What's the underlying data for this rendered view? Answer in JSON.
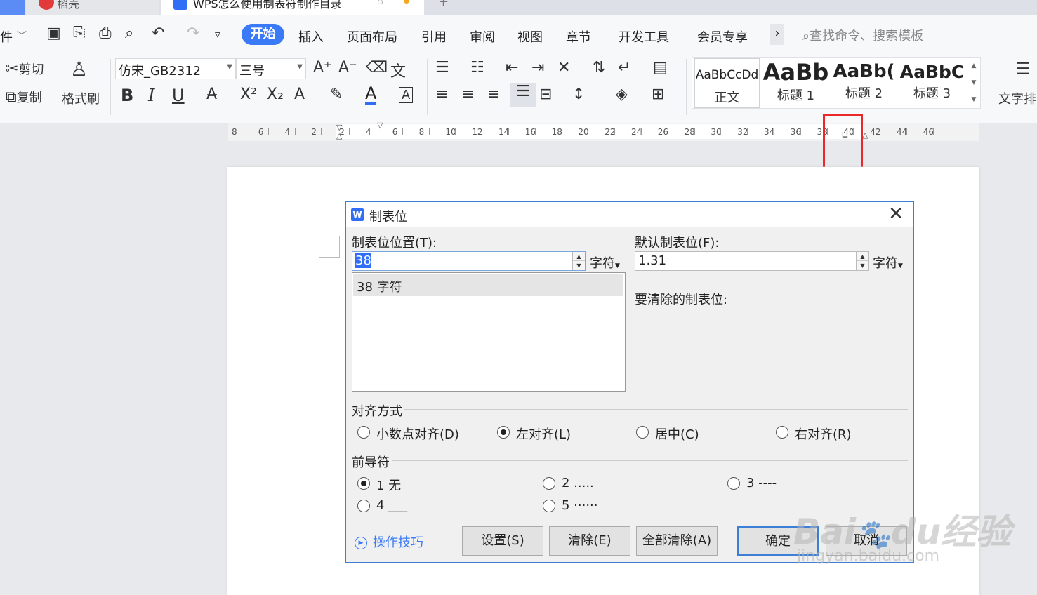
{
  "tabs": {
    "tab1_title": "稻壳",
    "tab2_title": "WPS怎么使用制表符制作目录",
    "new_tab": "+"
  },
  "menu": {
    "file": "件",
    "items": [
      "开始",
      "插入",
      "页面布局",
      "引用",
      "审阅",
      "视图",
      "章节",
      "开发工具",
      "会员专享"
    ],
    "more": "›",
    "search_placeholder": "查找命令、搜索模板"
  },
  "toolbar": {
    "cut": "剪切",
    "copy": "复制",
    "format_painter": "格式刷",
    "font_name": "仿宋_GB2312",
    "font_size": "三号",
    "bold": "B",
    "italic": "I",
    "underline": "U",
    "text_layout": "文字排"
  },
  "styles": [
    {
      "preview": "AaBbCcDd",
      "name": "正文"
    },
    {
      "preview": "AaBb",
      "name": "标题 1"
    },
    {
      "preview": "AaBb(",
      "name": "标题 2"
    },
    {
      "preview": "AaBbC",
      "name": "标题 3"
    }
  ],
  "ruler": {
    "labels": [
      "8",
      "6",
      "4",
      "2",
      "2",
      "4",
      "6",
      "8",
      "10",
      "12",
      "14",
      "16",
      "18",
      "20",
      "22",
      "24",
      "26",
      "28",
      "30",
      "32",
      "34",
      "36",
      "38",
      "40",
      "42",
      "44",
      "46"
    ]
  },
  "dialog": {
    "title": "制表位",
    "tab_position_label": "制表位位置(T):",
    "tab_position_value": "38",
    "unit": "字符",
    "default_tab_label": "默认制表位(F):",
    "default_tab_value": "1.31",
    "tab_list": [
      "38 字符"
    ],
    "to_clear_label": "要清除的制表位:",
    "alignment_label": "对齐方式",
    "alignment_options": [
      "小数点对齐(D)",
      "左对齐(L)",
      "居中(C)",
      "右对齐(R)"
    ],
    "alignment_selected": "左对齐(L)",
    "leader_label": "前导符",
    "leader_options": [
      "1 无",
      "2 .....",
      "3 ----",
      "4 ___",
      "5 ······"
    ],
    "leader_selected": "1 无",
    "tips": "操作技巧",
    "buttons": {
      "set": "设置(S)",
      "clear": "清除(E)",
      "clear_all": "全部清除(A)",
      "ok": "确定",
      "cancel": "取消"
    }
  },
  "watermark": {
    "main": "Baidu经验",
    "url": "jingyan.baidu.com"
  },
  "colors": {
    "accent": "#3a7af6",
    "highlight_box": "#e8282a"
  }
}
